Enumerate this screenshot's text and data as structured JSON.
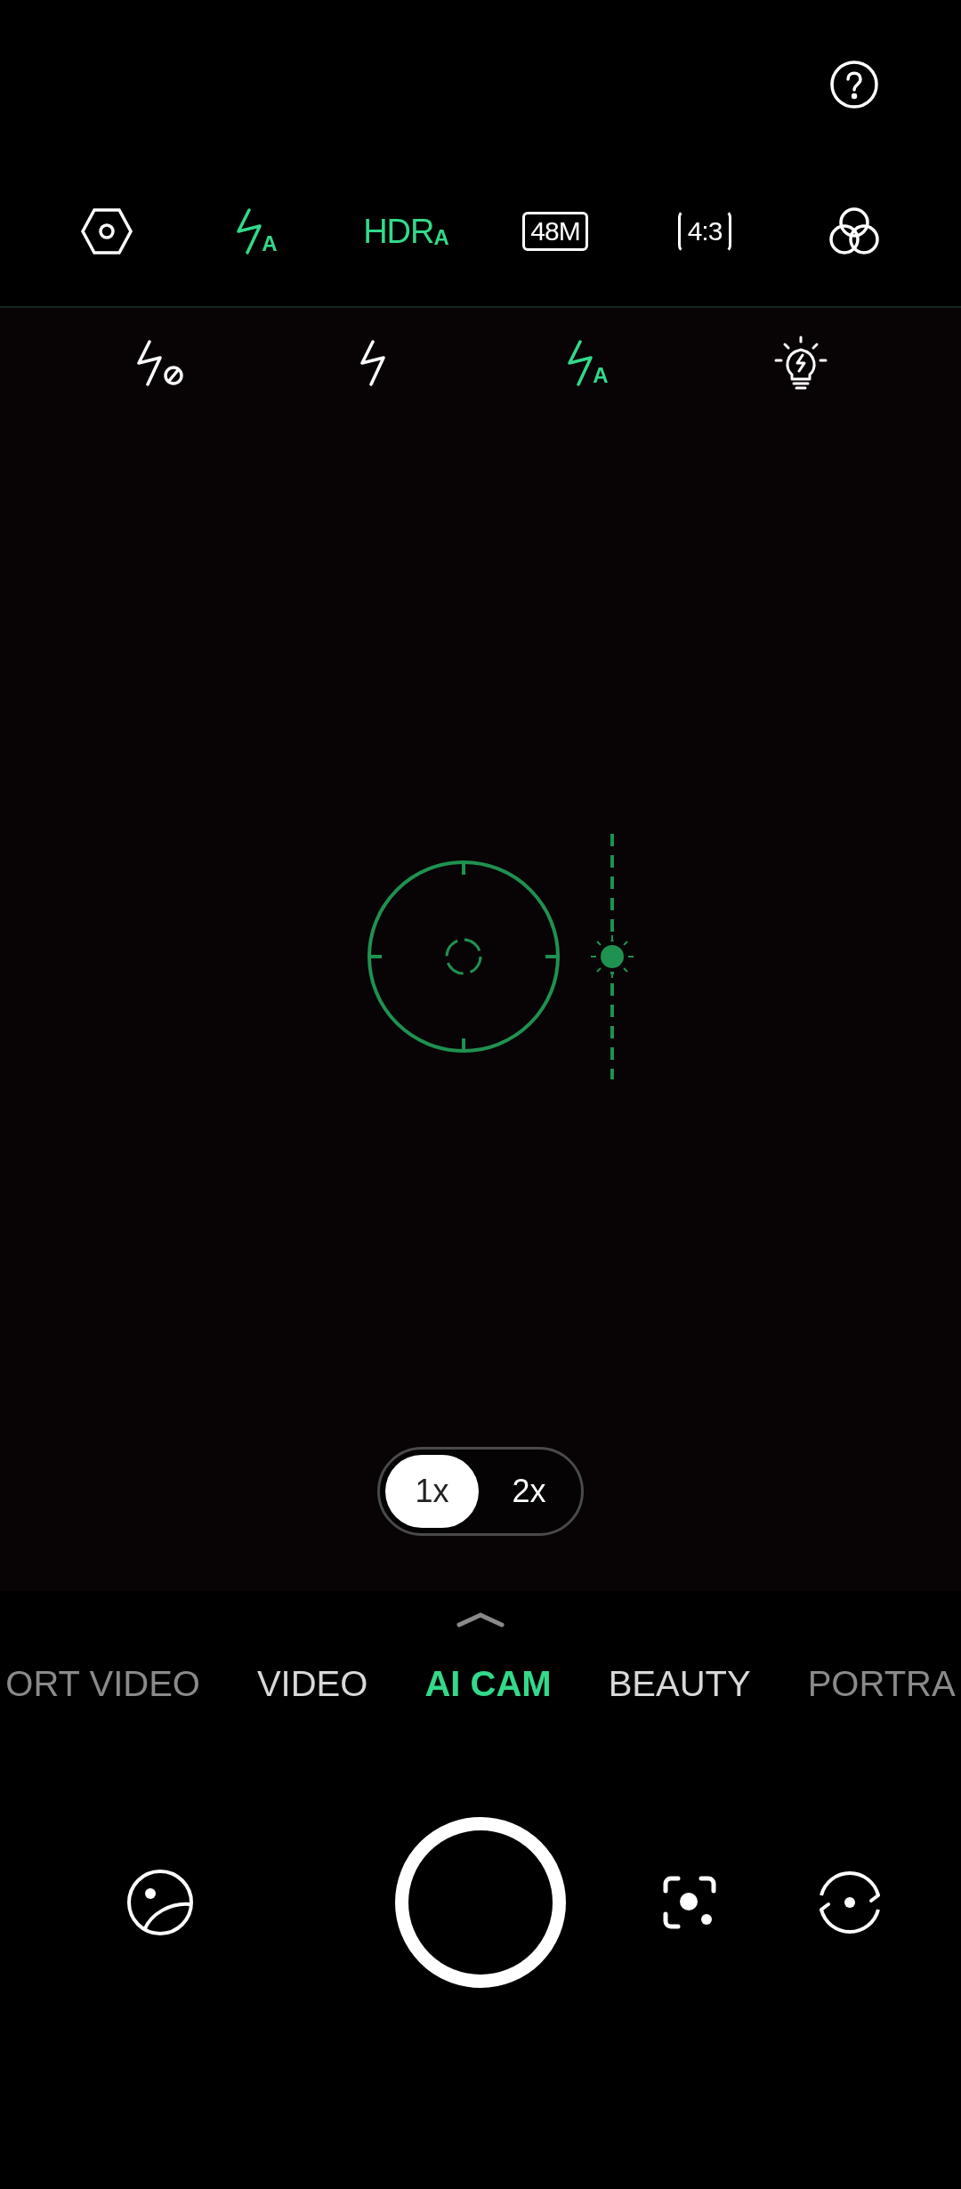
{
  "help": {
    "kind": "help"
  },
  "toolbar": [
    {
      "kind": "settings",
      "active": false
    },
    {
      "kind": "flash",
      "badge": "A",
      "active": true
    },
    {
      "kind": "hdr",
      "label": "HDR$_{A}$",
      "active": true
    },
    {
      "kind": "resolution",
      "label": "48M",
      "active": false
    },
    {
      "kind": "ratio",
      "label": "4:3",
      "active": false
    },
    {
      "kind": "filters",
      "active": false
    }
  ],
  "flash_options": [
    {
      "kind": "off",
      "selected": false
    },
    {
      "kind": "on",
      "selected": false
    },
    {
      "kind": "auto",
      "badge": "A",
      "selected": true
    },
    {
      "kind": "torch",
      "selected": false
    }
  ],
  "exposure": {
    "level": 0.5
  },
  "zoom": [
    {
      "label": "1x",
      "selected": true
    },
    {
      "label": "2x",
      "selected": false
    }
  ],
  "modes": [
    {
      "label": "ORT VIDEO",
      "selected": false,
      "edge": true
    },
    {
      "label": "VIDEO",
      "selected": false,
      "edge": false
    },
    {
      "label": "AI CAM",
      "selected": true,
      "edge": false
    },
    {
      "label": "BEAUTY",
      "selected": false,
      "edge": false
    },
    {
      "label": "PORTRA",
      "selected": false,
      "edge": true
    }
  ],
  "controls": [
    {
      "kind": "gallery"
    },
    {
      "kind": "shutter"
    },
    {
      "kind": "lens"
    },
    {
      "kind": "flip"
    }
  ]
}
